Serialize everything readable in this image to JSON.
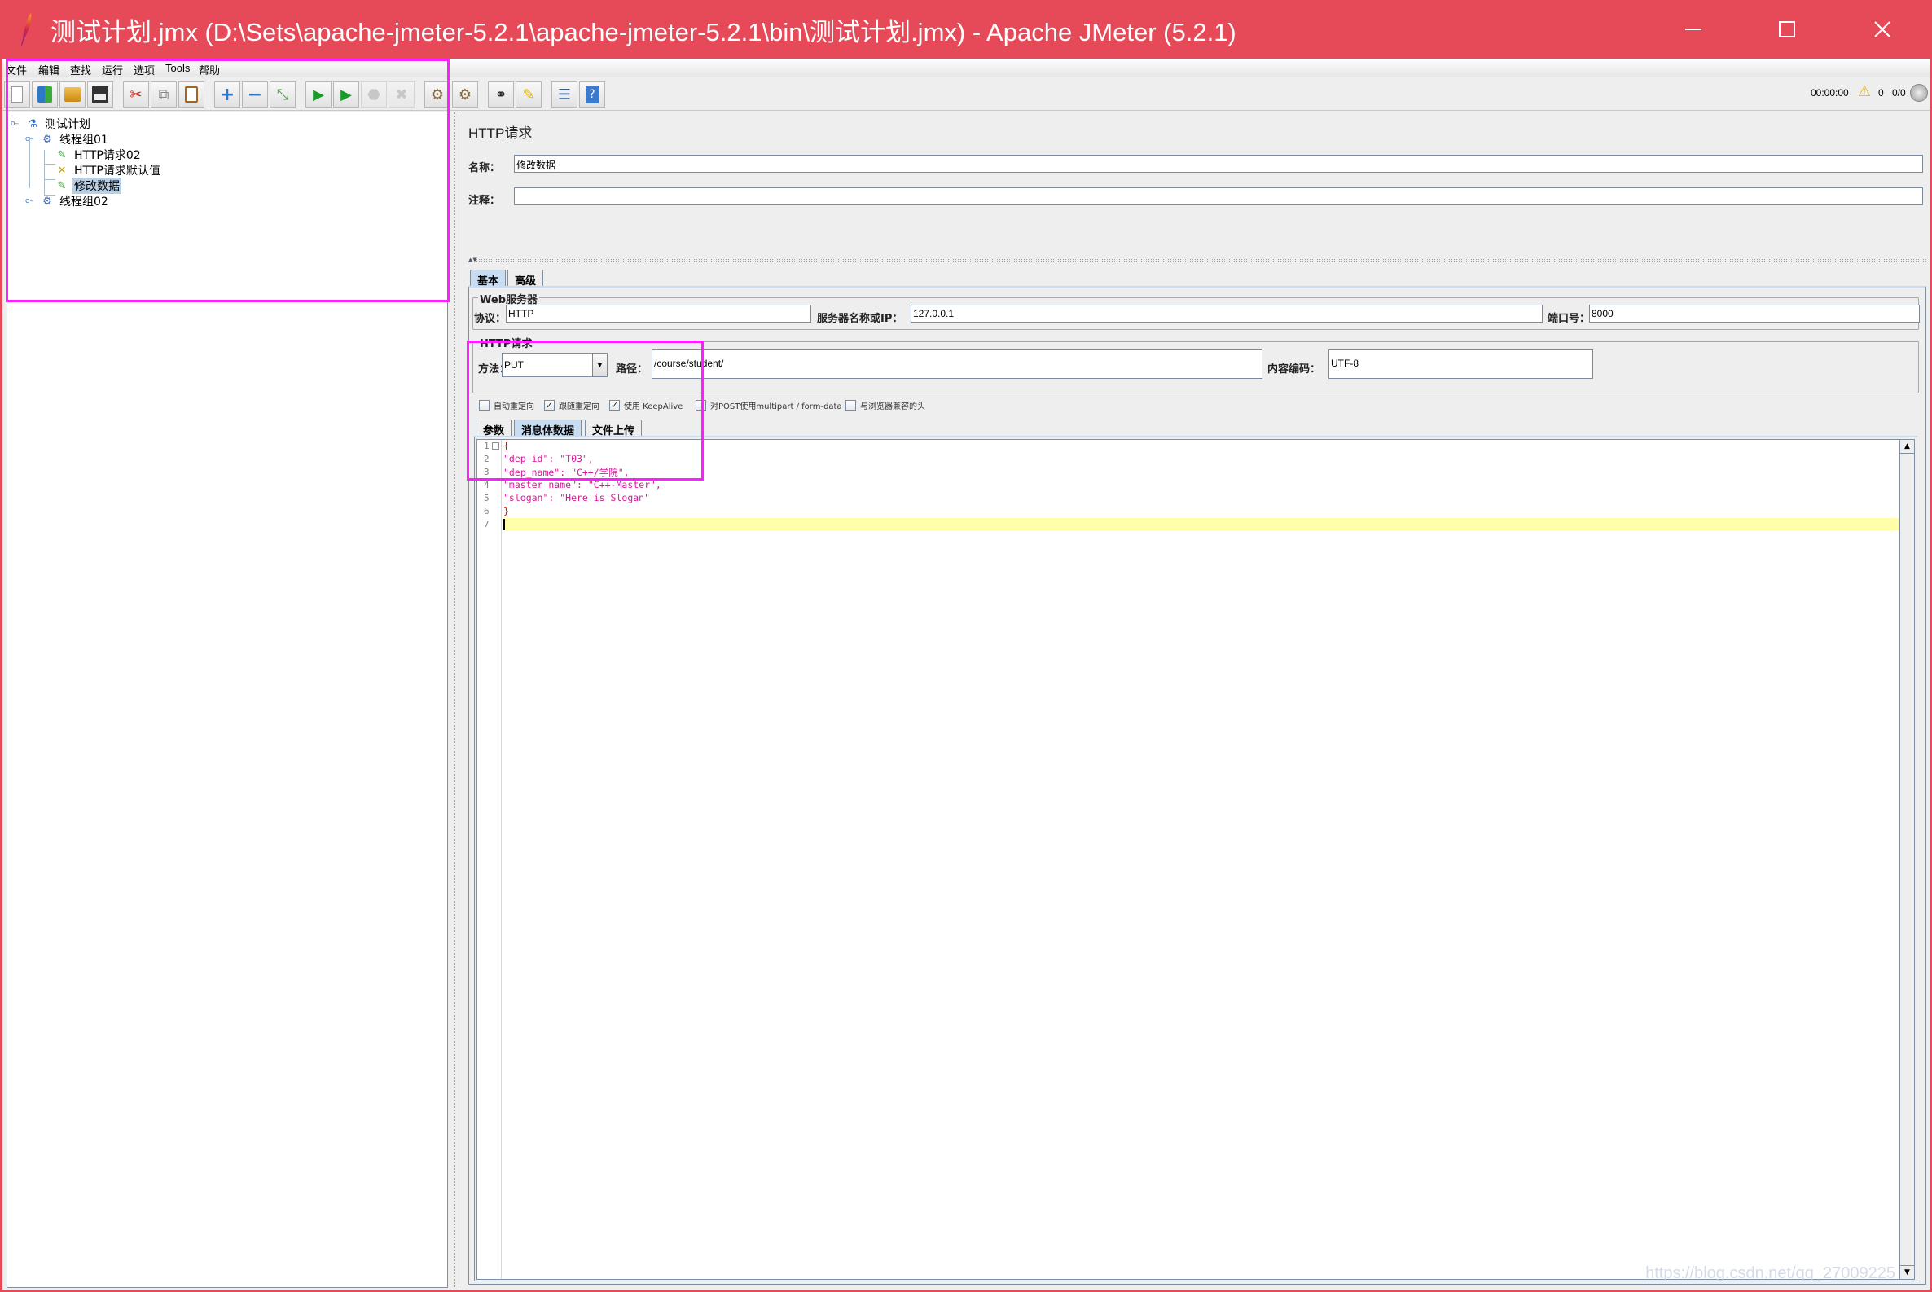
{
  "window": {
    "title": "测试计划.jmx (D:\\Sets\\apache-jmeter-5.2.1\\apache-jmeter-5.2.1\\bin\\测试计划.jmx) - Apache JMeter (5.2.1)",
    "titlebar_color": "#e64a58",
    "controls": [
      "minimize",
      "maximize",
      "close"
    ]
  },
  "menubar": {
    "items": [
      "文件",
      "编辑",
      "查找",
      "运行",
      "选项",
      "Tools",
      "帮助"
    ]
  },
  "toolbar": {
    "buttons": [
      {
        "name": "new",
        "icon": "new-document-icon",
        "glyph": "📄"
      },
      {
        "name": "templates",
        "icon": "templates-icon",
        "glyph": "📚"
      },
      {
        "name": "open",
        "icon": "open-folder-icon",
        "glyph": "📂"
      },
      {
        "name": "save",
        "icon": "save-floppy-icon",
        "glyph": "💾"
      },
      {
        "name": "cut",
        "icon": "scissors-icon",
        "glyph": "✂"
      },
      {
        "name": "copy",
        "icon": "copy-icon",
        "glyph": "⧉"
      },
      {
        "name": "paste",
        "icon": "clipboard-icon",
        "glyph": "📋"
      },
      {
        "name": "expand",
        "icon": "plus-icon",
        "glyph": "+"
      },
      {
        "name": "collapse",
        "icon": "minus-icon",
        "glyph": "−"
      },
      {
        "name": "toggle",
        "icon": "toggle-icon",
        "glyph": "⤡"
      },
      {
        "name": "start",
        "icon": "play-icon",
        "glyph": "▶"
      },
      {
        "name": "start-no-pauses",
        "icon": "play-no-timers-icon",
        "glyph": "▶"
      },
      {
        "name": "stop",
        "icon": "stop-icon",
        "glyph": "⬣"
      },
      {
        "name": "shutdown",
        "icon": "shutdown-icon",
        "glyph": "✖"
      },
      {
        "name": "clear",
        "icon": "clear-broom-icon",
        "glyph": "🧹"
      },
      {
        "name": "clear-all",
        "icon": "clear-all-broom-icon",
        "glyph": "🧹"
      },
      {
        "name": "search",
        "icon": "binoculars-icon",
        "glyph": "🔭"
      },
      {
        "name": "reset-search",
        "icon": "broom-icon",
        "glyph": "🧹"
      },
      {
        "name": "function-helper",
        "icon": "list-icon",
        "glyph": "☰"
      },
      {
        "name": "help",
        "icon": "help-book-icon",
        "glyph": "?"
      }
    ],
    "status": {
      "elapsed": "00:00:00",
      "warnings": "0",
      "threads": "0/0"
    }
  },
  "tree": {
    "nodes": [
      {
        "label": "测试计划",
        "icon": "test-plan-flask-icon",
        "level": 0,
        "expanded": true
      },
      {
        "label": "线程组01",
        "icon": "thread-group-gear-icon",
        "level": 1,
        "expanded": true
      },
      {
        "label": "HTTP请求02",
        "icon": "sampler-pipette-icon",
        "level": 2
      },
      {
        "label": "HTTP请求默认值",
        "icon": "config-tools-icon",
        "level": 2
      },
      {
        "label": "修改数据",
        "icon": "sampler-pipette-icon",
        "level": 2,
        "selected": true
      },
      {
        "label": "线程组02",
        "icon": "thread-group-gear-icon",
        "level": 1,
        "expanded": false
      }
    ]
  },
  "panel": {
    "title": "HTTP请求",
    "name_label": "名称：",
    "name_value": "修改数据",
    "comment_label": "注释：",
    "comment_value": "",
    "tabs": [
      {
        "label": "基本",
        "active": true
      },
      {
        "label": "高级",
        "active": false
      }
    ],
    "web_server": {
      "group_label": "Web服务器",
      "protocol_label": "协议：",
      "protocol_value": "HTTP",
      "server_label": "服务器名称或IP：",
      "server_value": "127.0.0.1",
      "port_label": "端口号：",
      "port_value": "8000"
    },
    "http_request": {
      "group_label": "HTTP请求",
      "method_label": "方法：",
      "method_value": "PUT",
      "path_label": "路径：",
      "path_value": "/course/student/",
      "encoding_label": "内容编码：",
      "encoding_value": "UTF-8"
    },
    "options": [
      {
        "label": "自动重定向",
        "checked": false
      },
      {
        "label": "跟随重定向",
        "checked": true
      },
      {
        "label": "使用 KeepAlive",
        "checked": true
      },
      {
        "label": "对POST使用multipart / form-data",
        "checked": false
      },
      {
        "label": "与浏览器兼容的头",
        "checked": false
      }
    ],
    "body_tabs": [
      {
        "label": "参数",
        "active": false
      },
      {
        "label": "消息体数据",
        "active": true
      },
      {
        "label": "文件上传",
        "active": false
      }
    ],
    "body_lines": [
      "{",
      "\"dep_id\": \"T03\",",
      "\"dep_name\": \"C++/学院\",",
      "\"master_name\": \"C++-Master\",",
      "\"slogan\": \"Here is Slogan\"",
      "}",
      ""
    ],
    "line_numbers": [
      "1",
      "2",
      "3",
      "4",
      "5",
      "6",
      "7"
    ]
  },
  "watermark": "https://blog.csdn.net/qq_27009225",
  "highlight_color": "#ff1eff"
}
